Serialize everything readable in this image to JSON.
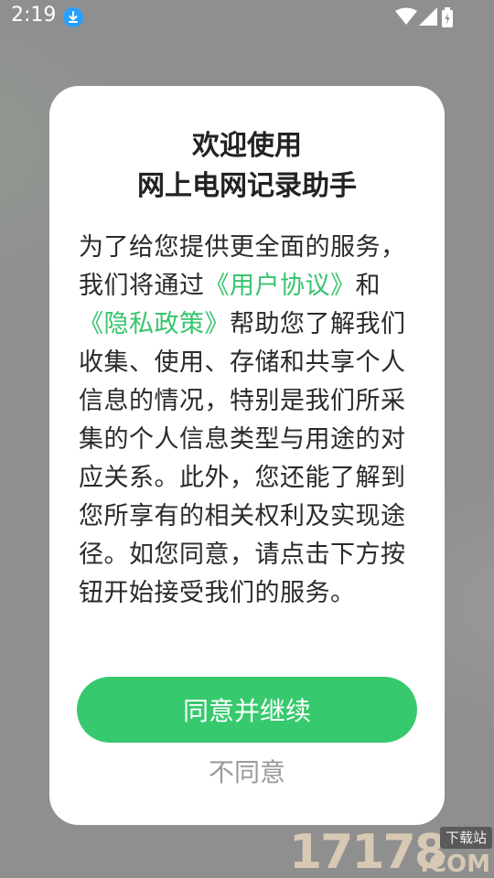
{
  "status_bar": {
    "time": "2:19",
    "icons": [
      "download-icon",
      "wifi-icon",
      "signal-icon",
      "battery-icon"
    ]
  },
  "dialog": {
    "title_line1": "欢迎使用",
    "title_line2": "网上电网记录助手",
    "body": {
      "text_before": "为了给您提供更全面的服务，我们将通过",
      "user_agreement_link": "《用户协议》",
      "and_text": "和",
      "privacy_policy_link": "《隐私政策》",
      "text_after": "帮助您了解我们收集、使用、存储和共享个人信息的情况，特别是我们所采集的个人信息类型与用途的对应关系。此外，您还能了解到您所享有的相关权利及实现途径。如您同意，请点击下方按钮开始接受我们的服务。"
    },
    "agree_button": "同意并继续",
    "disagree_button": "不同意"
  },
  "watermark": {
    "digits": "17178",
    "domain": ".COM",
    "tag": "下载站"
  },
  "colors": {
    "accent": "#36c96d",
    "link": "#36c46c",
    "overlay": "#8f8f8f"
  }
}
